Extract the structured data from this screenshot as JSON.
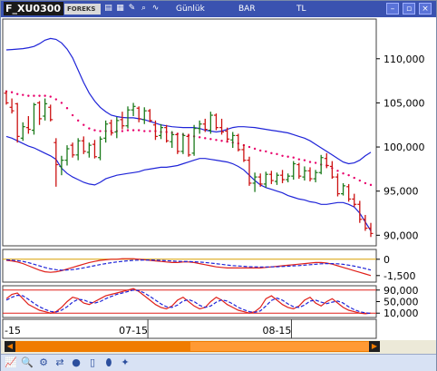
{
  "window": {
    "symbol": "F_XU0300",
    "brand": "FOREKS",
    "period": "Günlük",
    "chart_style": "BAR",
    "currency": "TL",
    "buttons": {
      "minimize": "–",
      "restore": "▫",
      "close": "×"
    }
  },
  "toolbar_icons": [
    "chart-icon",
    "grid-icon",
    "draw-icon",
    "zoom-icon",
    "analyze-icon"
  ],
  "bottom_icons": [
    "chart-line-icon",
    "zoom-icon",
    "settings-icon",
    "compare-icon",
    "database-icon",
    "document-icon",
    "cylinder-icon",
    "wand-icon"
  ],
  "colors": {
    "up_bar": "#1a7a1a",
    "down_bar": "#cc1111",
    "bollinger": "#1f24d8",
    "sar": "#e8006b",
    "macd": "#e0201a",
    "macd_signal": "#1f24d8",
    "macd_zero": "#d8a000",
    "stoch_level": "#e0201a",
    "scrollbar": "#f07c00"
  },
  "chart_data": [
    {
      "type": "bar",
      "name": "price",
      "ylim": [
        88800,
        114500
      ],
      "yticks": [
        "110,000",
        "105,000",
        "100,000",
        "95,000",
        "90,000"
      ],
      "ytick_values": [
        110000,
        105000,
        100000,
        95000,
        90000
      ],
      "xticks": [
        "-15",
        "07-15",
        "08-15"
      ],
      "xtick_index": [
        1,
        23,
        49
      ],
      "ohlc": [
        [
          106100,
          106400,
          104800,
          105000
        ],
        [
          104500,
          105500,
          103800,
          104100
        ],
        [
          104900,
          105000,
          100500,
          101200
        ],
        [
          101000,
          102800,
          100700,
          102300
        ],
        [
          102200,
          103500,
          101500,
          102000
        ],
        [
          101900,
          105000,
          101400,
          104800
        ],
        [
          105000,
          105200,
          102500,
          103200
        ],
        [
          103500,
          105500,
          103000,
          104900
        ],
        [
          104500,
          104800,
          102900,
          103100
        ],
        [
          100500,
          101000,
          95500,
          98000
        ],
        [
          97800,
          99000,
          96800,
          98500
        ],
        [
          98500,
          100200,
          97900,
          99800
        ],
        [
          100200,
          100500,
          98800,
          99100
        ],
        [
          99100,
          101000,
          98500,
          100700
        ],
        [
          100700,
          101200,
          99200,
          99500
        ],
        [
          99400,
          100500,
          98800,
          100200
        ],
        [
          100300,
          100800,
          98700,
          98900
        ],
        [
          98800,
          101200,
          98500,
          100900
        ],
        [
          101000,
          103000,
          100500,
          102600
        ],
        [
          102700,
          103100,
          101300,
          101600
        ],
        [
          101700,
          103400,
          101000,
          103000
        ],
        [
          103100,
          104000,
          102000,
          102400
        ],
        [
          102400,
          104600,
          102100,
          104200
        ],
        [
          104200,
          105000,
          103500,
          104600
        ],
        [
          104400,
          104600,
          102800,
          103200
        ],
        [
          103100,
          104500,
          102600,
          104100
        ],
        [
          104100,
          104300,
          102800,
          103000
        ],
        [
          102500,
          103000,
          100800,
          101200
        ],
        [
          101300,
          102600,
          100900,
          102200
        ],
        [
          102200,
          102500,
          100500,
          100700
        ],
        [
          100600,
          101800,
          99900,
          101400
        ],
        [
          101400,
          101600,
          99200,
          99500
        ],
        [
          99500,
          101600,
          99200,
          101300
        ],
        [
          101200,
          101500,
          98900,
          99100
        ],
        [
          99300,
          102500,
          99000,
          102100
        ],
        [
          102100,
          103000,
          101500,
          102600
        ],
        [
          102600,
          103200,
          101700,
          102000
        ],
        [
          101900,
          104000,
          101500,
          103600
        ],
        [
          103600,
          103800,
          101900,
          102200
        ],
        [
          102200,
          103200,
          101400,
          101700
        ],
        [
          101800,
          102200,
          100600,
          100900
        ],
        [
          100800,
          101700,
          99900,
          101300
        ],
        [
          101300,
          101500,
          99500,
          99700
        ],
        [
          99700,
          100300,
          98300,
          98500
        ],
        [
          98500,
          98900,
          95600,
          95900
        ],
        [
          95900,
          97100,
          94900,
          96600
        ],
        [
          96600,
          97000,
          95500,
          95800
        ],
        [
          95800,
          97200,
          95400,
          96900
        ],
        [
          96900,
          97300,
          95800,
          96200
        ],
        [
          96100,
          97100,
          95700,
          96800
        ],
        [
          96800,
          97400,
          95900,
          96300
        ],
        [
          96300,
          97000,
          96000,
          96700
        ],
        [
          96700,
          98400,
          96300,
          98100
        ],
        [
          98000,
          98200,
          96400,
          96700
        ],
        [
          96600,
          97800,
          96200,
          97300
        ],
        [
          97300,
          97700,
          96100,
          96400
        ],
        [
          96400,
          97400,
          96000,
          97100
        ],
        [
          97100,
          99100,
          96900,
          98800
        ],
        [
          98700,
          99300,
          97600,
          97900
        ],
        [
          97800,
          98400,
          96400,
          96600
        ],
        [
          96600,
          97000,
          94400,
          94700
        ],
        [
          94700,
          95900,
          94500,
          95600
        ],
        [
          95500,
          95800,
          93800,
          94100
        ],
        [
          94100,
          94700,
          93200,
          93500
        ],
        [
          93500,
          93900,
          91400,
          91800
        ],
        [
          91800,
          92300,
          90500,
          90800
        ],
        [
          90800,
          91400,
          89800,
          90200
        ]
      ],
      "bb_upper": [
        111000,
        111050,
        111100,
        111150,
        111250,
        111400,
        111700,
        112100,
        112300,
        112200,
        111800,
        111100,
        110100,
        108700,
        107300,
        106100,
        105200,
        104500,
        104000,
        103600,
        103450,
        103350,
        103300,
        103300,
        103200,
        103100,
        102900,
        102700,
        102500,
        102400,
        102300,
        102250,
        102200,
        102200,
        102200,
        102100,
        101900,
        101800,
        101700,
        101800,
        102000,
        102200,
        102300,
        102300,
        102250,
        102200,
        102100,
        102000,
        101900,
        101800,
        101700,
        101600,
        101400,
        101200,
        101000,
        100700,
        100300,
        99900,
        99500,
        99100,
        98700,
        98300,
        98100,
        98200,
        98500,
        99000,
        99400
      ],
      "bb_lower": [
        101200,
        101000,
        100700,
        100400,
        100100,
        99900,
        99600,
        99300,
        99000,
        98600,
        97600,
        97000,
        96600,
        96300,
        96000,
        95800,
        95700,
        96000,
        96400,
        96600,
        96800,
        96900,
        97000,
        97100,
        97200,
        97400,
        97500,
        97600,
        97700,
        97700,
        97800,
        97900,
        98100,
        98300,
        98500,
        98700,
        98700,
        98600,
        98500,
        98400,
        98300,
        98100,
        97800,
        97400,
        96800,
        96200,
        95700,
        95400,
        95200,
        95000,
        94800,
        94500,
        94300,
        94100,
        94000,
        93800,
        93700,
        93500,
        93500,
        93600,
        93700,
        93700,
        93500,
        93200,
        92500,
        91500,
        90500
      ],
      "sar": [
        106300,
        106200,
        106000,
        105900,
        105800,
        105800,
        105800,
        105800,
        105700,
        105400,
        105000,
        104400,
        103600,
        103000,
        102500,
        102100,
        101900,
        101800,
        101800,
        101800,
        101800,
        101800,
        101900,
        101900,
        101900,
        101800,
        101800,
        101800,
        101700,
        101700,
        101600,
        101500,
        101400,
        101300,
        101200,
        101100,
        101000,
        100900,
        100800,
        100700,
        100600,
        100500,
        100400,
        100200,
        100000,
        99800,
        99600,
        99500,
        99300,
        99200,
        99000,
        98900,
        98800,
        98600,
        98500,
        98300,
        98200,
        98000,
        97900,
        97600,
        97300,
        97000,
        96800,
        96500,
        96200,
        95900,
        95700
      ]
    },
    {
      "type": "line",
      "name": "macd",
      "ylim": [
        -2100,
        900
      ],
      "yticks": [
        "0",
        "-1,500"
      ],
      "ytick_values": [
        0,
        -1500
      ],
      "reference_line": 0,
      "series": [
        {
          "values": [
            -100,
            -150,
            -250,
            -400,
            -600,
            -800,
            -1000,
            -1150,
            -1200,
            -1150,
            -1050,
            -900,
            -750,
            -600,
            -450,
            -300,
            -200,
            -100,
            -50,
            0,
            0,
            50,
            50,
            50,
            0,
            -50,
            -100,
            -150,
            -200,
            -250,
            -300,
            -300,
            -250,
            -250,
            -300,
            -400,
            -500,
            -600,
            -700,
            -750,
            -800,
            -800,
            -800,
            -800,
            -800,
            -800,
            -800,
            -750,
            -700,
            -650,
            -600,
            -550,
            -500,
            -450,
            -400,
            -350,
            -300,
            -300,
            -350,
            -450,
            -600,
            -750,
            -900,
            -1050,
            -1200,
            -1350,
            -1500
          ]
        },
        {
          "values": [
            -50,
            -80,
            -130,
            -200,
            -320,
            -460,
            -610,
            -760,
            -880,
            -960,
            -1000,
            -990,
            -950,
            -880,
            -790,
            -690,
            -590,
            -490,
            -400,
            -320,
            -250,
            -190,
            -140,
            -100,
            -80,
            -70,
            -70,
            -80,
            -100,
            -130,
            -160,
            -190,
            -200,
            -210,
            -230,
            -260,
            -300,
            -350,
            -410,
            -470,
            -530,
            -580,
            -620,
            -650,
            -680,
            -700,
            -710,
            -710,
            -700,
            -690,
            -670,
            -640,
            -610,
            -580,
            -540,
            -500,
            -460,
            -420,
            -400,
            -400,
            -420,
            -470,
            -540,
            -630,
            -740,
            -860,
            -990
          ]
        }
      ]
    },
    {
      "type": "line",
      "name": "stochastic",
      "ylim": [
        -5000,
        105000
      ],
      "yticks": [
        "90,000",
        "50,000",
        "10,000"
      ],
      "ytick_values": [
        90000,
        50000,
        10000
      ],
      "reference_lines": [
        90000,
        10000
      ],
      "series": [
        {
          "values": [
            60000,
            75000,
            80000,
            60000,
            40000,
            30000,
            20000,
            15000,
            10000,
            15000,
            30000,
            50000,
            65000,
            60000,
            45000,
            40000,
            50000,
            60000,
            70000,
            75000,
            80000,
            85000,
            90000,
            95000,
            85000,
            70000,
            55000,
            40000,
            30000,
            25000,
            35000,
            55000,
            65000,
            50000,
            35000,
            25000,
            30000,
            50000,
            65000,
            55000,
            40000,
            30000,
            20000,
            15000,
            10000,
            15000,
            30000,
            60000,
            70000,
            55000,
            40000,
            30000,
            25000,
            35000,
            55000,
            65000,
            45000,
            35000,
            50000,
            60000,
            45000,
            30000,
            20000,
            15000,
            10000,
            8000,
            10000
          ]
        },
        {
          "values": [
            55000,
            65000,
            72000,
            70000,
            58000,
            44000,
            32000,
            23000,
            16000,
            14000,
            20000,
            32000,
            48000,
            58000,
            56000,
            48000,
            45000,
            50000,
            60000,
            68000,
            75000,
            80000,
            85000,
            90000,
            88000,
            80000,
            68000,
            55000,
            42000,
            32000,
            30000,
            38000,
            52000,
            57000,
            50000,
            37000,
            30000,
            35000,
            48000,
            56000,
            52000,
            42000,
            30000,
            22000,
            15000,
            13000,
            18000,
            35000,
            54000,
            62000,
            55000,
            42000,
            32000,
            30000,
            38000,
            52000,
            55000,
            48000,
            43000,
            48000,
            52000,
            45000,
            32000,
            22000,
            15000,
            11000,
            9000
          ]
        }
      ]
    }
  ]
}
